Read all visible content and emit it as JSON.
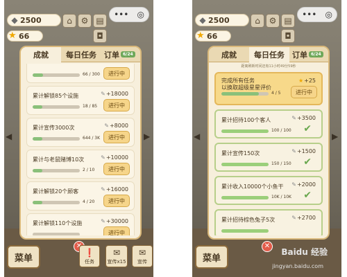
{
  "left_screen": {
    "coins": "2500",
    "stars": "66",
    "tabs": {
      "achievements": "成就",
      "daily": "每日任务",
      "orders": "订单",
      "orders_badge": "6/24"
    },
    "items": [
      {
        "title": "",
        "progress": "66 / 300",
        "fill": 0.22,
        "button": "进行中",
        "reward": ""
      },
      {
        "title": "累计解锁85个设施",
        "progress": "18 / 85",
        "fill": 0.21,
        "button": "进行中",
        "reward": "+18000"
      },
      {
        "title": "累计宣传3000次",
        "progress": "644 / 3K",
        "fill": 0.21,
        "button": "进行中",
        "reward": "+8000"
      },
      {
        "title": "累计与老鼠赌博10次",
        "progress": "2 / 10",
        "fill": 0.2,
        "button": "进行中",
        "reward": "+10000"
      },
      {
        "title": "累计解锁20个顾客",
        "progress": "4 / 20",
        "fill": 0.2,
        "button": "进行中",
        "reward": "+16000"
      },
      {
        "title": "累计解锁110个设施",
        "progress": "",
        "fill": 0.0,
        "button": "进行中",
        "reward": "+30000"
      }
    ],
    "bottom": {
      "menu": "菜单",
      "task": "任务",
      "promo": "宣传x15",
      "promo2": "宣传"
    }
  },
  "right_screen": {
    "coins": "2500",
    "stars": "66",
    "tabs": {
      "achievements": "成就",
      "daily": "每日任务",
      "orders": "订单",
      "orders_badge": "6/24"
    },
    "note": "距离刷新时间还有11小时49分59秒",
    "highlight": {
      "title_line1": "完成所有任务",
      "title_line2": "以换取超级星星评价",
      "reward": "+25",
      "progress": "4 / 5",
      "fill": 0.8,
      "button": "进行中"
    },
    "items": [
      {
        "title": "累计招待100个客人",
        "progress": "100 / 100",
        "fill": 1.0,
        "reward": "+3500"
      },
      {
        "title": "累计宣传150次",
        "progress": "150 / 150",
        "fill": 1.0,
        "reward": "+1500"
      },
      {
        "title": "累计收入10000个小鱼干",
        "progress": "10K / 10K",
        "fill": 1.0,
        "reward": "+2000"
      },
      {
        "title": "累计招待棕色兔子5次",
        "progress": "",
        "fill": 1.0,
        "reward": "+2700"
      }
    ],
    "bottom": {
      "menu": "菜单"
    }
  },
  "icons": {
    "coin": "coin-icon",
    "star": "star-icon",
    "fish": "fish-icon"
  },
  "watermark": {
    "brand": "Baidu 经验",
    "url": "jingyan.baidu.com"
  }
}
